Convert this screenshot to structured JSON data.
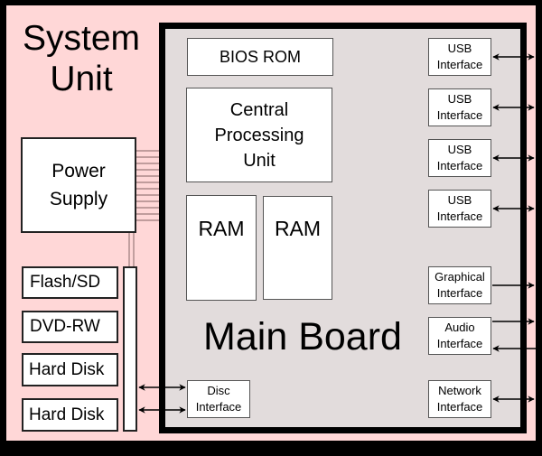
{
  "title": [
    "System",
    "Unit"
  ],
  "main_board": {
    "label": "Main Board",
    "bios": "BIOS ROM",
    "cpu": [
      "Central",
      "Processing",
      "Unit"
    ],
    "ram": [
      "RAM",
      "RAM"
    ],
    "usb": [
      [
        "USB",
        "Interface"
      ],
      [
        "USB",
        "Interface"
      ],
      [
        "USB",
        "Interface"
      ],
      [
        "USB",
        "Interface"
      ]
    ],
    "graphical": [
      "Graphical",
      "Interface"
    ],
    "audio": [
      "Audio",
      "Interface"
    ],
    "network": [
      "Network",
      "Interface"
    ],
    "disc": [
      "Disc",
      "Interface"
    ]
  },
  "power_supply": [
    "Power",
    "Supply"
  ],
  "drives": [
    "Flash/SD",
    "DVD-RW",
    "Hard Disk",
    "Hard Disk"
  ],
  "colors": {
    "system_unit": "#ffd7d7",
    "main_board": "#e2dcdc",
    "border": "#000000"
  }
}
